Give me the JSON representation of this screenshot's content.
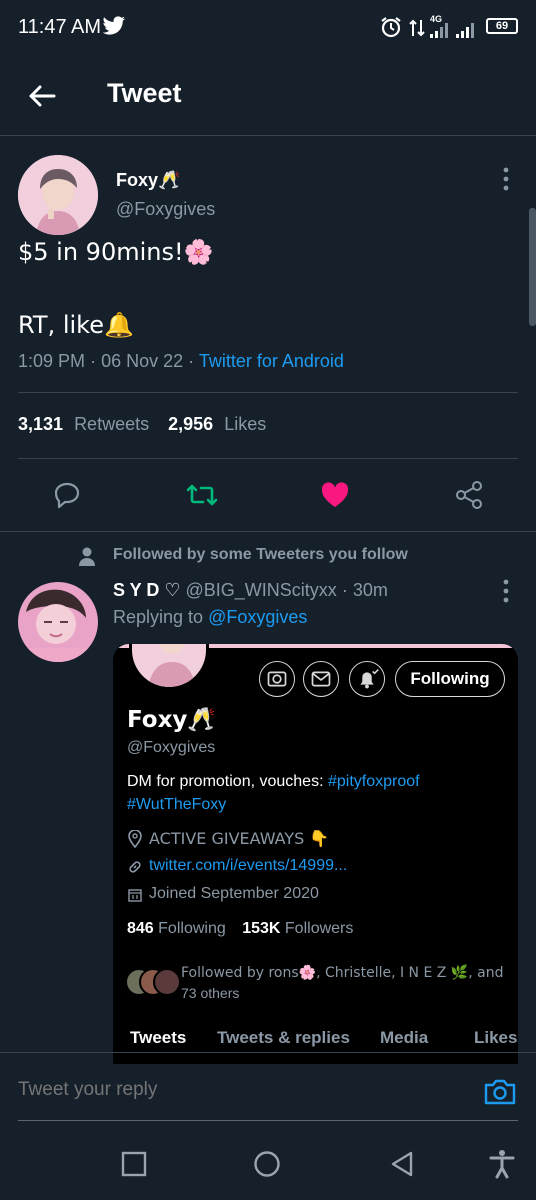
{
  "status_bar": {
    "time": "11:47 AM",
    "network": "4G",
    "battery": "69"
  },
  "header": {
    "title": "Tweet"
  },
  "tweet": {
    "author_name": "Foxy🥂",
    "author_handle": "@Foxygives",
    "text_line1": "$5 in 90mins!🌸",
    "text_line2": "RT, like🔔",
    "time": "1:09 PM",
    "date": "06 Nov 22",
    "source": "Twitter for Android",
    "retweets_count": "3,131",
    "retweets_label": "Retweets",
    "likes_count": "2,956",
    "likes_label": "Likes"
  },
  "reply": {
    "social_context": "Followed by some Tweeters you follow",
    "author_name": "S Y D ♡",
    "author_handle": "@BIG_WINScityxx",
    "time_ago": "· 30m",
    "replying_label": "Replying to",
    "replying_handle": "@Foxygives"
  },
  "profile_card": {
    "name": "Foxy🥂",
    "handle": "@Foxygives",
    "bio_line1_text": "DM for promotion, vouches: ",
    "bio_hashtag1": "#pityfoxproof",
    "bio_hashtag2": "#WutTheFoxy",
    "location": "ACTIVE GIVEAWAYS 👇",
    "link": "twitter.com/i/events/14999...",
    "joined": "Joined September 2020",
    "following_count": "846",
    "following_label": "Following",
    "followers_count": "153K",
    "followers_label": "Followers",
    "followed_by_line1": "Followed by rons🌸, Christelle, I N E Z 🌿, and",
    "followed_by_line2": "73 others",
    "following_button": "Following",
    "tabs": [
      "Tweets",
      "Tweets & replies",
      "Media",
      "Likes"
    ]
  },
  "reply_bar": {
    "placeholder": "Tweet your reply"
  },
  "colors": {
    "background": "#15202b",
    "accent": "#1d9bf0",
    "like": "#f91880",
    "retweet": "#00ba7c"
  }
}
